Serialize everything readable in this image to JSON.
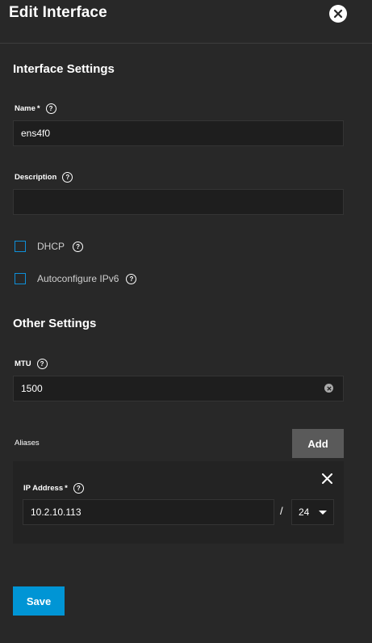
{
  "header": {
    "title": "Edit Interface"
  },
  "interface_settings": {
    "title": "Interface Settings",
    "name_label": "Name",
    "required_mark": "*",
    "name_value": "ens4f0",
    "description_label": "Description",
    "description_value": "",
    "dhcp_label": "DHCP",
    "dhcp_checked": false,
    "ipv6_label": "Autoconfigure IPv6",
    "ipv6_checked": false
  },
  "other_settings": {
    "title": "Other Settings",
    "mtu_label": "MTU",
    "mtu_value": "1500"
  },
  "aliases": {
    "label": "Aliases",
    "add_label": "Add",
    "items": [
      {
        "ip_label": "IP Address",
        "required_mark": "*",
        "ip_value": "10.2.10.113",
        "separator": "/",
        "netmask": "24"
      }
    ]
  },
  "footer": {
    "save_label": "Save"
  },
  "colors": {
    "accent": "#0095d5",
    "checkbox_border": "#0e8fd8",
    "background": "#282828"
  },
  "icons": {
    "close": "close-circle-icon",
    "help": "help-circle-icon",
    "clear": "clear-circle-icon",
    "remove": "close-icon",
    "caret": "chevron-down-icon"
  }
}
